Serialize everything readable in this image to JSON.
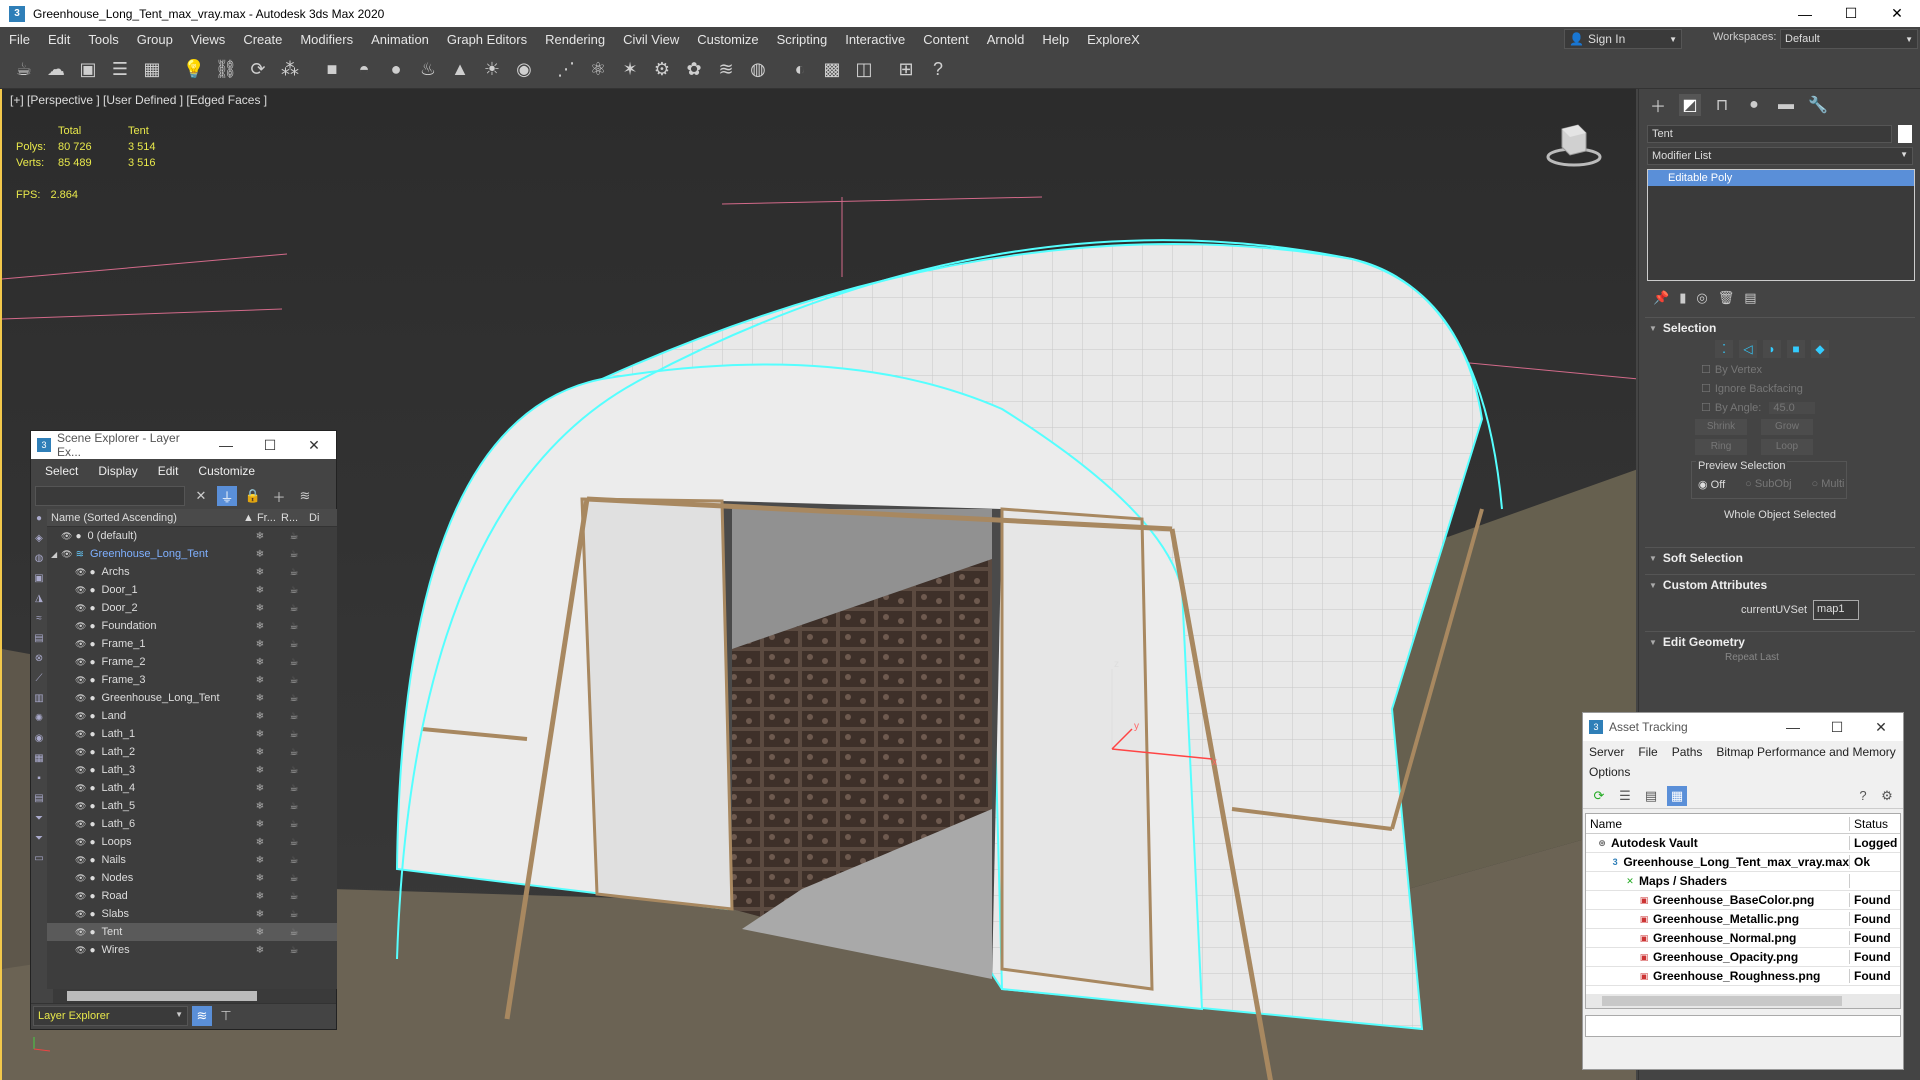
{
  "window": {
    "title": "Greenhouse_Long_Tent_max_vray.max - Autodesk 3ds Max 2020",
    "app_icon": "3",
    "minimize": "—",
    "maximize": "☐",
    "close": "✕"
  },
  "menu": {
    "items": [
      "File",
      "Edit",
      "Tools",
      "Group",
      "Views",
      "Create",
      "Modifiers",
      "Animation",
      "Graph Editors",
      "Rendering",
      "Civil View",
      "Customize",
      "Scripting",
      "Interactive",
      "Content",
      "Arnold",
      "Help",
      "ExploreX"
    ],
    "signin": "Sign In",
    "workspaces_label": "Workspaces:",
    "workspace": "Default"
  },
  "viewport": {
    "label": "[+] [Perspective ] [User Defined ] [Edged Faces ]",
    "stats": {
      "header_total": "Total",
      "header_tent": "Tent",
      "polys_label": "Polys:",
      "polys_total": "80 726",
      "polys_tent": "3 514",
      "verts_label": "Verts:",
      "verts_total": "85 489",
      "verts_tent": "3 516",
      "fps_label": "FPS:",
      "fps_value": "2.864"
    },
    "axis": {
      "x": "x",
      "y": "y",
      "z": "z"
    }
  },
  "scene_explorer": {
    "title": "Scene Explorer - Layer Ex...",
    "menu": [
      "Select",
      "Display",
      "Edit",
      "Customize"
    ],
    "header_name": "Name (Sorted Ascending)",
    "header_frozen": "▲ Fr...",
    "header_render": "R...",
    "header_disp": "Di",
    "rows": [
      {
        "name": "0 (default)",
        "depth": 1,
        "layer": false,
        "sel": false
      },
      {
        "name": "Greenhouse_Long_Tent",
        "depth": 0,
        "layer": true,
        "sel": false
      },
      {
        "name": "Archs",
        "depth": 2,
        "layer": false,
        "sel": false
      },
      {
        "name": "Door_1",
        "depth": 2,
        "layer": false,
        "sel": false
      },
      {
        "name": "Door_2",
        "depth": 2,
        "layer": false,
        "sel": false
      },
      {
        "name": "Foundation",
        "depth": 2,
        "layer": false,
        "sel": false
      },
      {
        "name": "Frame_1",
        "depth": 2,
        "layer": false,
        "sel": false
      },
      {
        "name": "Frame_2",
        "depth": 2,
        "layer": false,
        "sel": false
      },
      {
        "name": "Frame_3",
        "depth": 2,
        "layer": false,
        "sel": false
      },
      {
        "name": "Greenhouse_Long_Tent",
        "depth": 2,
        "layer": false,
        "sel": false
      },
      {
        "name": "Land",
        "depth": 2,
        "layer": false,
        "sel": false
      },
      {
        "name": "Lath_1",
        "depth": 2,
        "layer": false,
        "sel": false
      },
      {
        "name": "Lath_2",
        "depth": 2,
        "layer": false,
        "sel": false
      },
      {
        "name": "Lath_3",
        "depth": 2,
        "layer": false,
        "sel": false
      },
      {
        "name": "Lath_4",
        "depth": 2,
        "layer": false,
        "sel": false
      },
      {
        "name": "Lath_5",
        "depth": 2,
        "layer": false,
        "sel": false
      },
      {
        "name": "Lath_6",
        "depth": 2,
        "layer": false,
        "sel": false
      },
      {
        "name": "Loops",
        "depth": 2,
        "layer": false,
        "sel": false
      },
      {
        "name": "Nails",
        "depth": 2,
        "layer": false,
        "sel": false
      },
      {
        "name": "Nodes",
        "depth": 2,
        "layer": false,
        "sel": false
      },
      {
        "name": "Road",
        "depth": 2,
        "layer": false,
        "sel": false
      },
      {
        "name": "Slabs",
        "depth": 2,
        "layer": false,
        "sel": false
      },
      {
        "name": "Tent",
        "depth": 2,
        "layer": false,
        "sel": true
      },
      {
        "name": "Wires",
        "depth": 2,
        "layer": false,
        "sel": false
      }
    ],
    "footer_combo": "Layer Explorer"
  },
  "command_panel": {
    "object_name": "Tent",
    "modifier_list": "Modifier List",
    "stack_item": "Editable Poly",
    "selection": {
      "title": "Selection",
      "by_vertex": "By Vertex",
      "ignore_backfacing": "Ignore Backfacing",
      "by_angle": "By Angle:",
      "angle_value": "45.0",
      "shrink": "Shrink",
      "grow": "Grow",
      "ring": "Ring",
      "loop": "Loop",
      "preview_selection": "Preview Selection",
      "off": "Off",
      "subobj": "SubObj",
      "multi": "Multi",
      "status": "Whole Object Selected"
    },
    "soft_selection": "Soft Selection",
    "custom_attributes": "Custom Attributes",
    "current_uvset_label": "currentUVSet",
    "current_uvset_value": "map1",
    "edit_geometry": "Edit Geometry",
    "repeat_last": "Repeat Last"
  },
  "asset_tracking": {
    "title": "Asset Tracking",
    "menu": [
      "Server",
      "File",
      "Paths",
      "Bitmap Performance and Memory",
      "Options"
    ],
    "header_name": "Name",
    "header_status": "Status",
    "rows": [
      {
        "name": "Autodesk Vault",
        "status": "Logged",
        "depth": 1,
        "icon": "vault"
      },
      {
        "name": "Greenhouse_Long_Tent_max_vray.max",
        "status": "Ok",
        "depth": 2,
        "icon": "max"
      },
      {
        "name": "Maps / Shaders",
        "status": "",
        "depth": 3,
        "icon": "maps"
      },
      {
        "name": "Greenhouse_BaseColor.png",
        "status": "Found",
        "depth": 4,
        "icon": "png"
      },
      {
        "name": "Greenhouse_Metallic.png",
        "status": "Found",
        "depth": 4,
        "icon": "png"
      },
      {
        "name": "Greenhouse_Normal.png",
        "status": "Found",
        "depth": 4,
        "icon": "png"
      },
      {
        "name": "Greenhouse_Opacity.png",
        "status": "Found",
        "depth": 4,
        "icon": "png"
      },
      {
        "name": "Greenhouse_Roughness.png",
        "status": "Found",
        "depth": 4,
        "icon": "png"
      }
    ]
  }
}
